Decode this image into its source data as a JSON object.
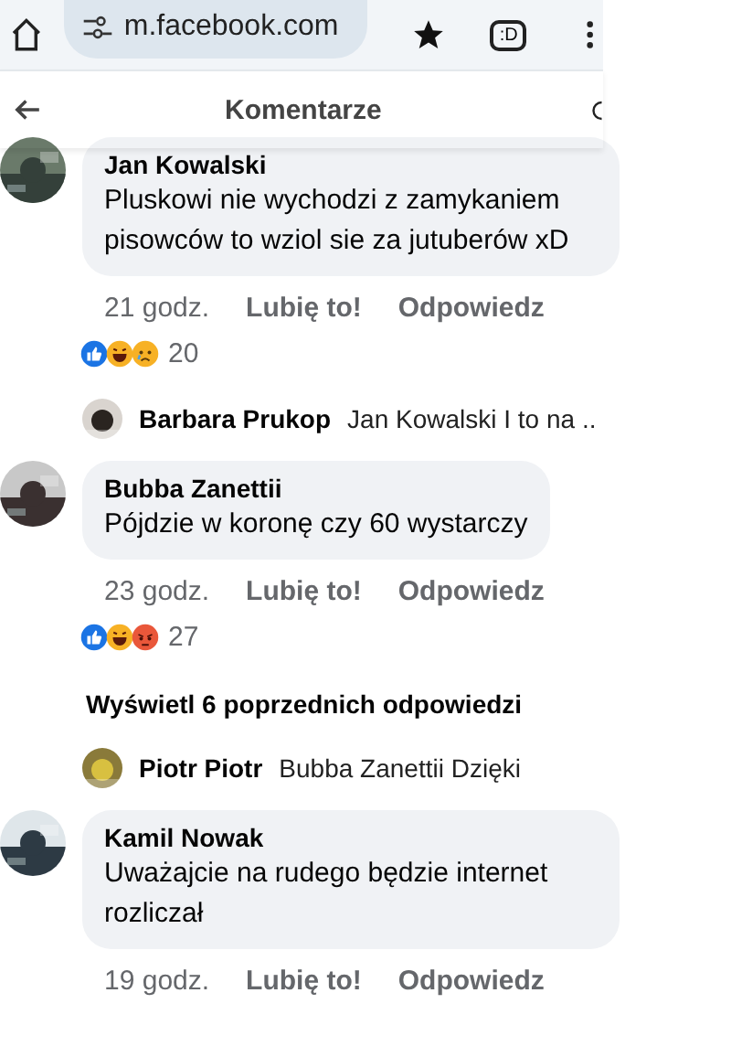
{
  "browser": {
    "url": "m.facebook.com",
    "tab_label": ":D"
  },
  "header": {
    "title": "Komentarze"
  },
  "items": [
    {
      "kind": "comment",
      "author": "Jan Kowalski",
      "text": "Pluskowi nie wychodzi z zamykaniem pisowców to wziol sie za jutuberów xD",
      "time": "21 godz.",
      "like": "Lubię to!",
      "reply": "Odpowiedz",
      "reactions": [
        {
          "kind": "like"
        },
        {
          "kind": "haha"
        },
        {
          "kind": "sad"
        }
      ],
      "reaction_count": "20"
    },
    {
      "kind": "reply",
      "author": "Barbara Prukop",
      "text": "Jan Kowalski I to na .."
    },
    {
      "kind": "comment",
      "author": "Bubba Zanettii",
      "text": "Pójdzie w koronę czy 60 wystarczy",
      "time": "23 godz.",
      "like": "Lubię to!",
      "reply": "Odpowiedz",
      "reactions": [
        {
          "kind": "like"
        },
        {
          "kind": "haha"
        },
        {
          "kind": "angry"
        }
      ],
      "reaction_count": "27"
    },
    {
      "kind": "more",
      "text": "Wyświetl 6 poprzednich odpowiedzi"
    },
    {
      "kind": "reply",
      "author": "Piotr Piotr",
      "text": "Bubba Zanettii Dzięki"
    },
    {
      "kind": "comment",
      "author": "Kamil Nowak",
      "text": "Uważajcie na rudego będzie internet rozliczał",
      "time": "19 godz.",
      "like": "Lubię to!",
      "reply": "Odpowiedz"
    }
  ]
}
